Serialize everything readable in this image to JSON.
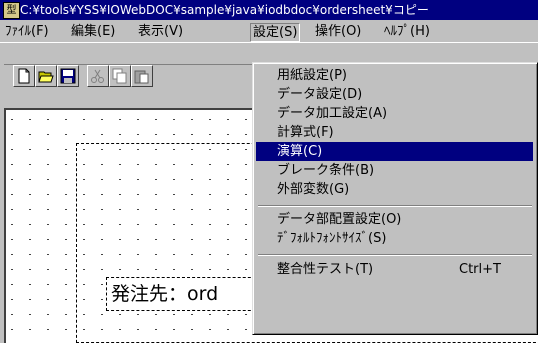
{
  "window": {
    "title": "C:¥tools¥YSS¥IOWebDOC¥sample¥java¥iodbdoc¥ordersheet¥コピー",
    "app_icon": "型"
  },
  "menubar": {
    "items": [
      {
        "label": "ﾌｧｲﾙ(F)"
      },
      {
        "label": "編集(E)"
      },
      {
        "label": "表示(V)"
      },
      {
        "label": "設定(S)"
      },
      {
        "label": "操作(O)"
      },
      {
        "label": "ﾍﾙﾌﾟ(H)"
      }
    ]
  },
  "toolbar": {
    "buttons": [
      {
        "name": "new-file-icon"
      },
      {
        "name": "open-folder-icon"
      },
      {
        "name": "save-disk-icon"
      },
      {
        "name": "cut-icon"
      },
      {
        "name": "copy-icon"
      },
      {
        "name": "paste-icon"
      }
    ]
  },
  "settings_menu": {
    "group1": [
      {
        "label": "用紙設定(P)"
      },
      {
        "label": "データ設定(D)"
      },
      {
        "label": "データ加工設定(A)"
      },
      {
        "label": "計算式(F)"
      },
      {
        "label": "演算(C)",
        "highlighted": true
      },
      {
        "label": "ブレーク条件(B)"
      },
      {
        "label": "外部変数(G)"
      }
    ],
    "group2": [
      {
        "label": "データ部配置設定(O)"
      },
      {
        "label": "ﾃﾞﾌｫﾙﾄﾌｫﾝﾄｻｲｽﾞ(S)"
      }
    ],
    "group3": [
      {
        "label": "整合性テスト(T)",
        "shortcut": "Ctrl+T"
      }
    ]
  },
  "canvas": {
    "field_label": "発注先：ord"
  },
  "colors": {
    "titlebar": "#000080",
    "highlight": "#000080",
    "face": "#c0c0c0"
  }
}
